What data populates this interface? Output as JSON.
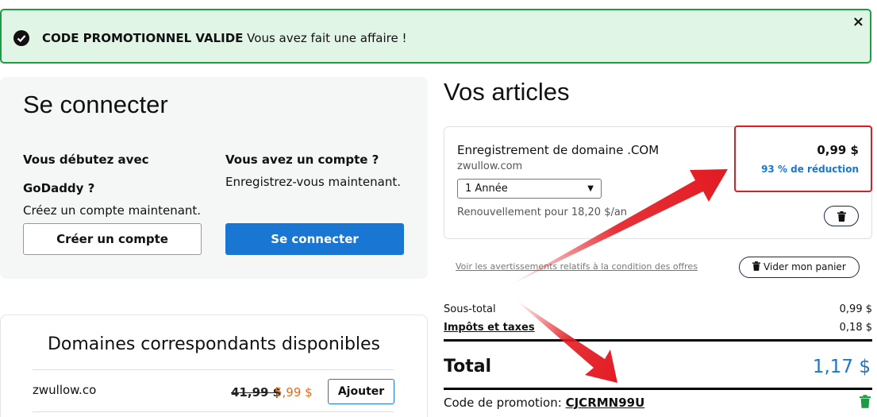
{
  "banner": {
    "code_label": "CODE PROMOTIONNEL VALIDE",
    "message": "Vous avez fait une affaire !",
    "close": "×"
  },
  "login": {
    "title": "Se connecter",
    "new_heading_1": "Vous débutez avec",
    "new_heading_2": "GoDaddy ?",
    "new_text": "Créez un compte maintenant.",
    "existing_heading": "Vous avez un compte ?",
    "existing_text": "Enregistrez-vous maintenant.",
    "create_button": "Créer un compte",
    "signin_button": "Se connecter"
  },
  "domains": {
    "title": "Domaines correspondants disponibles",
    "items": [
      {
        "name": "zwullow.co",
        "old_price": "41,99 $",
        "new_price": "5,99 $",
        "add_label": "Ajouter"
      }
    ]
  },
  "cart": {
    "title": "Vos articles",
    "item": {
      "name": "Enregistrement de domaine .COM",
      "domain": "zwullow.com",
      "term": "1 Année",
      "renewal": "Renouvellement pour 18,20 $/an",
      "price": "0,99 $",
      "discount": "93 % de réduction"
    },
    "offer_link": "Voir les avertissements relatifs à la condition des offres",
    "clear_button": "Vider mon panier",
    "subtotal_label": "Sous-total",
    "subtotal_value": "0,99 $",
    "tax_label": "Impôts et taxes",
    "tax_value": "0,18 $",
    "total_label": "Total",
    "total_value": "1,17 $",
    "promo_label": "Code de promotion:",
    "promo_code": "CJCRMN99U"
  },
  "colors": {
    "primary": "#1976d2",
    "success": "#1e9c45",
    "sale": "#e06c1f",
    "annotation": "#e31b23"
  }
}
